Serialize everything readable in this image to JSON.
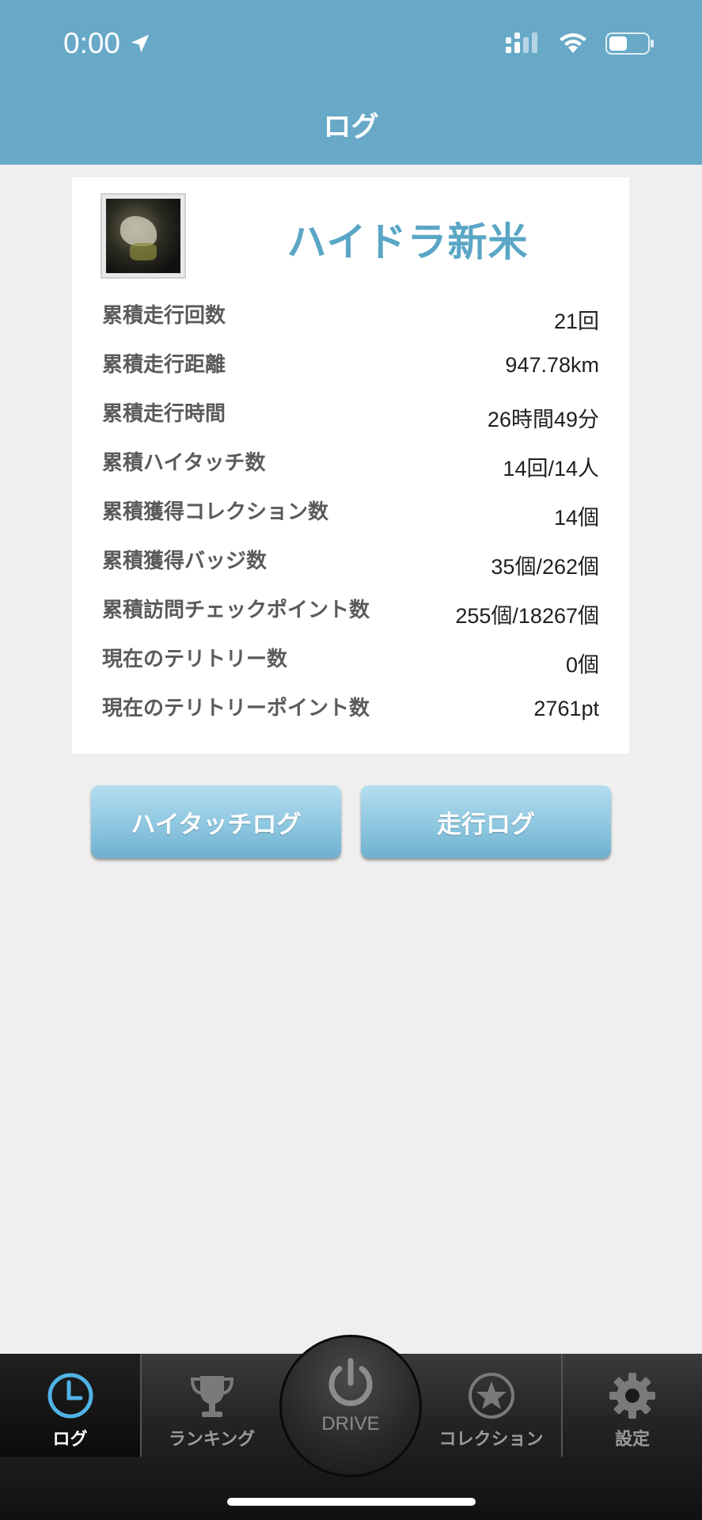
{
  "status_bar": {
    "time": "0:00"
  },
  "header": {
    "title": "ログ"
  },
  "profile": {
    "username": "ハイドラ新米"
  },
  "stats": [
    {
      "label": "累積走行回数",
      "value": "21回"
    },
    {
      "label": "累積走行距離",
      "value": "947.78km"
    },
    {
      "label": "累積走行時間",
      "value": "26時間49分"
    },
    {
      "label": "累積ハイタッチ数",
      "value": "14回/14人"
    },
    {
      "label": "累積獲得コレクション数",
      "value": "14個"
    },
    {
      "label": "累積獲得バッジ数",
      "value": "35個/262個"
    },
    {
      "label": "累積訪問チェックポイント数",
      "value": "255個/18267個"
    },
    {
      "label": "現在のテリトリー数",
      "value": "0個"
    },
    {
      "label": "現在のテリトリーポイント数",
      "value": "2761pt"
    }
  ],
  "buttons": {
    "hightouch_log": "ハイタッチログ",
    "drive_log": "走行ログ"
  },
  "tabbar": {
    "log": "ログ",
    "ranking": "ランキング",
    "drive": "DRIVE",
    "collection": "コレクション",
    "settings": "設定"
  },
  "colors": {
    "header": "#68a9c8",
    "accent": "#5aa6c6",
    "active_icon": "#4fb3e6"
  }
}
